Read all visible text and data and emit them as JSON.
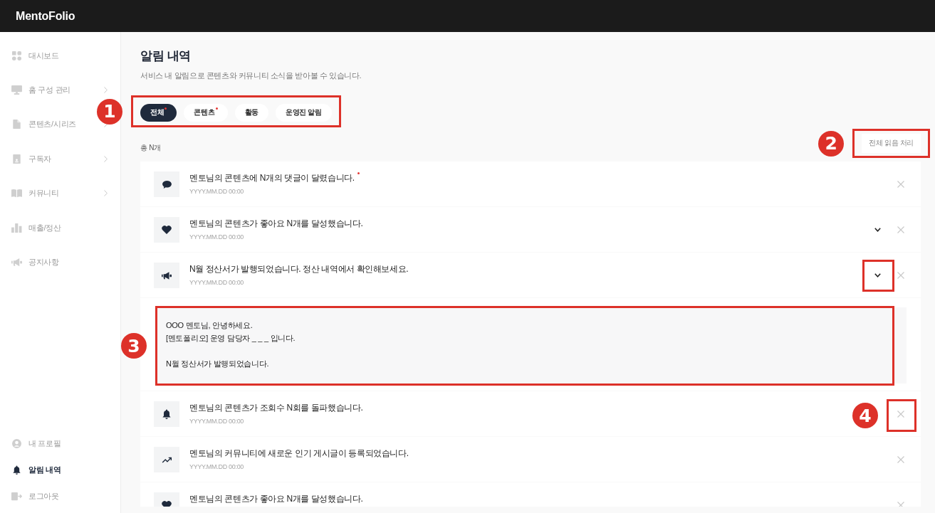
{
  "header": {
    "logo": "MentoFolio"
  },
  "sidebar": {
    "items": [
      {
        "label": "대시보드",
        "has_submenu": false,
        "selected": false
      },
      {
        "label": "홈 구성 관리",
        "has_submenu": true,
        "selected": false
      },
      {
        "label": "콘텐츠/시리즈",
        "has_submenu": true,
        "selected": false
      },
      {
        "label": "구독자",
        "has_submenu": true,
        "selected": false
      },
      {
        "label": "커뮤니티",
        "has_submenu": true,
        "selected": false
      },
      {
        "label": "매출/정산",
        "has_submenu": false,
        "selected": false
      },
      {
        "label": "공지사항",
        "has_submenu": false,
        "selected": false
      }
    ],
    "bottom_items": [
      {
        "label": "내 프로필",
        "selected": false
      },
      {
        "label": "알림 내역",
        "selected": true
      },
      {
        "label": "로그아웃",
        "selected": false
      }
    ]
  },
  "page": {
    "title": "알림 내역",
    "subtitle": "서비스 내 알림으로 콘텐츠와 커뮤니티 소식을 받아볼 수 있습니다."
  },
  "filter_tabs": {
    "annotation": {
      "framed": true,
      "number": "1"
    },
    "items": [
      {
        "label": "전체",
        "selected": true,
        "unread": true
      },
      {
        "label": "콘텐츠",
        "selected": false,
        "unread": true
      },
      {
        "label": "활동",
        "selected": false,
        "unread": false
      },
      {
        "label": "운영진 알림",
        "selected": false,
        "unread": false
      }
    ]
  },
  "toolbar": {
    "count": "총 N개",
    "mark_all_read": {
      "label": "전체 읽음 처리",
      "annotation": {
        "framed": true,
        "number": "2"
      }
    }
  },
  "notifications": [
    {
      "kind": "comment",
      "title": "멘토님의 콘텐츠에 N개의 댓글이 달렸습니다.",
      "date": "YYYY.MM.DD 00:00",
      "unread": true,
      "expandable": false,
      "expanded": false
    },
    {
      "kind": "like",
      "title": "멘토님의 콘텐츠가 좋아요 N개를 달성했습니다.",
      "date": "YYYY.MM.DD 00:00",
      "unread": false,
      "expandable": true,
      "expanded": false
    },
    {
      "kind": "notice",
      "title": "N월 정산서가 발행되었습니다. 정산 내역에서 확인해보세요.",
      "date": "YYYY.MM.DD 00:00",
      "unread": false,
      "expandable": true,
      "expanded": true,
      "expand_annotation": {
        "framed": true
      },
      "details": {
        "annotation": {
          "framed": true,
          "number": "3"
        },
        "paragraphs": [
          [
            "OOO 멘토님, 안녕하세요.",
            "[멘토폴리오] 운영 담당자 _ _ _ 입니다."
          ],
          [
            "N월 정산서가 발행되었습니다."
          ]
        ]
      }
    },
    {
      "kind": "views",
      "title": "멘토님의 콘텐츠가 조회수 N회를 돌파했습니다.",
      "date": "YYYY.MM.DD 00:00",
      "unread": false,
      "expandable": false,
      "expanded": false,
      "close_annotation": {
        "framed": true,
        "number": "4"
      }
    },
    {
      "kind": "trending",
      "title": "멘토님의 커뮤니티에 새로운 인기 게시글이 등록되었습니다.",
      "date": "YYYY.MM.DD 00:00",
      "unread": false,
      "expandable": false,
      "expanded": false
    },
    {
      "kind": "like",
      "title": "멘토님의 콘텐츠가 좋아요 N개를 달성했습니다.",
      "unread": false,
      "expandable": false,
      "expanded": false
    }
  ]
}
